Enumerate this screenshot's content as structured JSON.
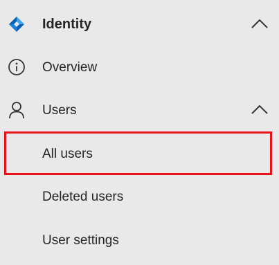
{
  "sidebar": {
    "identity": {
      "label": "Identity",
      "icon": "identity-diamond-icon",
      "expanded": true,
      "accent": "#0078d4"
    },
    "items": [
      {
        "label": "Overview",
        "icon": "info-circle-icon"
      },
      {
        "label": "Users",
        "icon": "person-icon",
        "expanded": true
      }
    ],
    "sub_items": [
      {
        "label": "All users",
        "selected": true
      },
      {
        "label": "Deleted users"
      },
      {
        "label": "User settings"
      }
    ],
    "highlight_color": "#e8121c"
  }
}
